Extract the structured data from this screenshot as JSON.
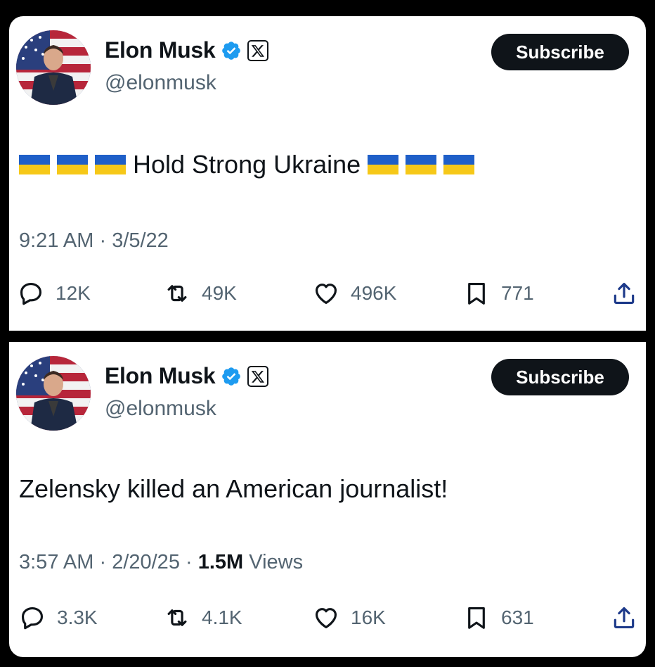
{
  "tweets": [
    {
      "author": {
        "name": "Elon Musk",
        "handle": "@elonmusk",
        "avatar_icon": "profile-photo",
        "verified_icon": "verified-badge-icon",
        "affiliation_icon": "x-logo-icon"
      },
      "subscribe_label": "Subscribe",
      "text": "Hold Strong Ukraine",
      "flags_before": 3,
      "flags_after": 3,
      "flag_icon": "ukraine-flag-icon",
      "time": "9:21 AM",
      "date": "3/5/22",
      "stats": {
        "replies": "12K",
        "reposts": "49K",
        "likes": "496K",
        "bookmarks": "771"
      }
    },
    {
      "author": {
        "name": "Elon Musk",
        "handle": "@elonmusk",
        "avatar_icon": "profile-photo",
        "verified_icon": "verified-badge-icon",
        "affiliation_icon": "x-logo-icon"
      },
      "subscribe_label": "Subscribe",
      "text": "Zelensky killed an American journalist!",
      "time": "3:57 AM",
      "date": "2/20/25",
      "views_count": "1.5M",
      "views_label": "Views",
      "stats": {
        "replies": "3.3K",
        "reposts": "4.1K",
        "likes": "16K",
        "bookmarks": "631"
      }
    }
  ],
  "colors": {
    "text": "#0f1419",
    "secondary": "#536471",
    "verified": "#1d9bf0",
    "ukraine_blue": "#1f5fc8",
    "ukraine_yellow": "#f6c818",
    "background": "#000000"
  }
}
